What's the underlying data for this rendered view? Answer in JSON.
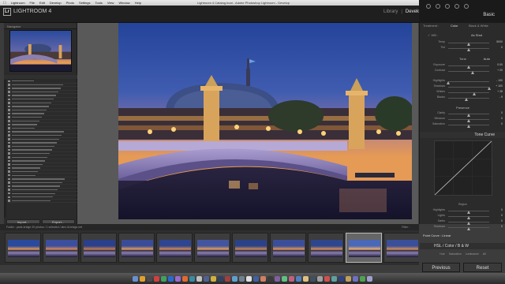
{
  "menubar": {
    "items": [
      "Lightroom",
      "File",
      "Edit",
      "Develop",
      "Photo",
      "Settings",
      "Tools",
      "View",
      "Window",
      "Help"
    ],
    "window_title": "Lightroom 4 Catalog.lrcat - Adobe Photoshop Lightroom - Develop",
    "status_right": "Mon 8:16 PM"
  },
  "app": {
    "logo": "Lr",
    "title": "LIGHTROOM 4",
    "modules": [
      "Library",
      "Develop"
    ],
    "module_separator": "|",
    "active_module": "Develop"
  },
  "left_panel": {
    "navigator_label": "Navigator",
    "collections_placeholder_rows": 34,
    "buttons": {
      "import": "Import...",
      "export": "Export..."
    }
  },
  "right_panel": {
    "panel_title": "Basic",
    "treatment": {
      "label": "Treatment :",
      "color": "Color",
      "bw": "Black & White"
    },
    "wb": {
      "label": "WB :",
      "value": "As Shot"
    },
    "sliders_wb": [
      {
        "label": "Temp",
        "value": "5000",
        "pos": 0.5
      },
      {
        "label": "Tint",
        "value": "0",
        "pos": 0.5
      }
    ],
    "tone": {
      "label": "Tone",
      "auto": "Auto"
    },
    "sliders_tone": [
      {
        "label": "Exposure",
        "value": "0.00",
        "pos": 0.5
      },
      {
        "label": "Contrast",
        "value": "+ 20",
        "pos": 0.6
      }
    ],
    "sliders_tone2": [
      {
        "label": "Highlights",
        "value": "- 100",
        "pos": 0.0
      },
      {
        "label": "Shadows",
        "value": "+ 100",
        "pos": 1.0
      },
      {
        "label": "Whites",
        "value": "+ 28",
        "pos": 0.64
      },
      {
        "label": "Blacks",
        "value": "- 9",
        "pos": 0.45
      }
    ],
    "presence": {
      "label": "Presence"
    },
    "sliders_presence": [
      {
        "label": "Clarity",
        "value": "0",
        "pos": 0.5
      },
      {
        "label": "Vibrance",
        "value": "0",
        "pos": 0.5
      },
      {
        "label": "Saturation",
        "value": "0",
        "pos": 0.5
      }
    ],
    "tone_curve_title": "Tone Curve",
    "region_label": "Region",
    "sliders_region": [
      {
        "label": "Highlights",
        "value": "0",
        "pos": 0.5
      },
      {
        "label": "Lights",
        "value": "0",
        "pos": 0.5
      },
      {
        "label": "Darks",
        "value": "0",
        "pos": 0.5
      },
      {
        "label": "Shadows",
        "value": "0",
        "pos": 0.5
      }
    ],
    "point_curve": {
      "label": "Point Curve :",
      "value": "Linear"
    },
    "hsl": {
      "title": "HSL",
      "sep": "/",
      "color": "Color",
      "bw": "B & W"
    },
    "hsl_tabs": [
      "Hue",
      "Saturation",
      "Luminance",
      "All"
    ],
    "buttons": {
      "previous": "Previous",
      "reset": "Reset"
    }
  },
  "filmstrip": {
    "info": "Folder : paris-bridge   20 photos / 1 selected / alex-iii-bridge.nef",
    "filter": "Filter :",
    "thumb_count": 11,
    "selected_index": 9
  },
  "colors": {
    "sky_top": "#2a4a9e",
    "sky_horizon": "#e59a56",
    "bridge": "#8a7fb2",
    "water": "#1b1a34"
  }
}
